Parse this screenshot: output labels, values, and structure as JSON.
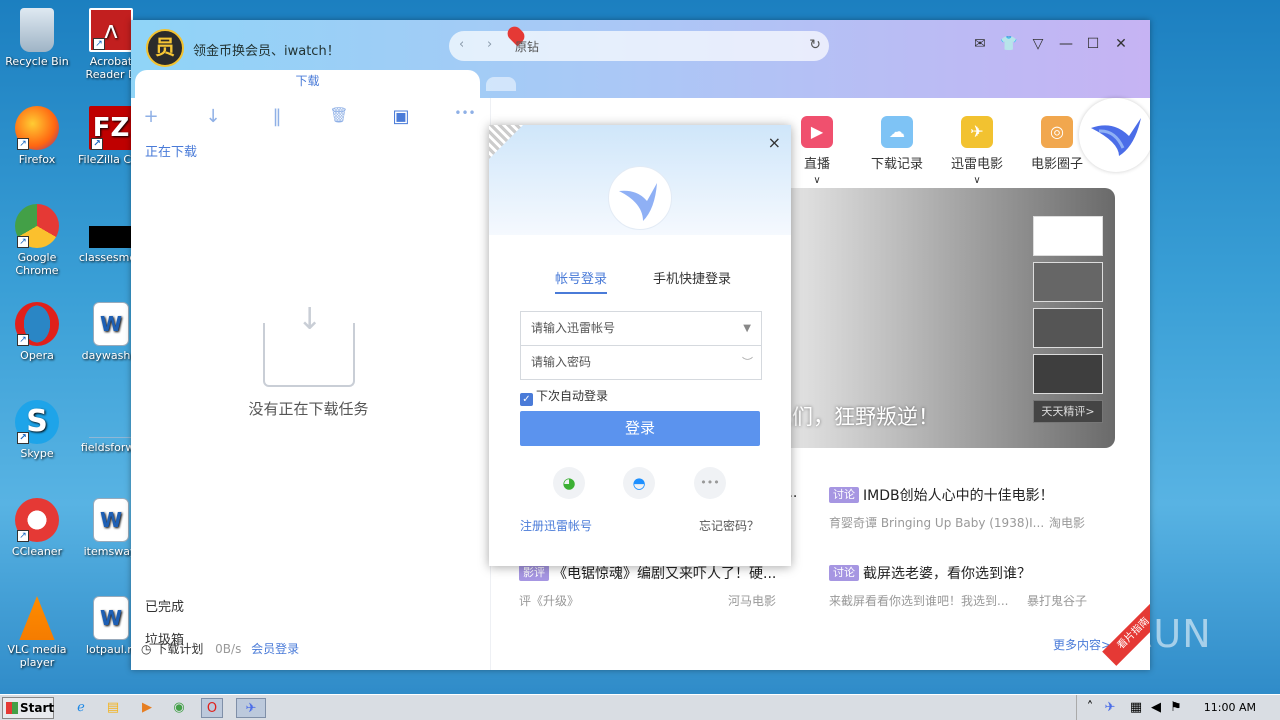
{
  "desktop": {
    "icons": [
      {
        "label": "Recycle Bin"
      },
      {
        "label": "Acrobat Reader D"
      },
      {
        "label": "Firefox"
      },
      {
        "label": "FileZilla Clie"
      },
      {
        "label": "Google Chrome"
      },
      {
        "label": "classesmen"
      },
      {
        "label": "Opera"
      },
      {
        "label": "daywashin"
      },
      {
        "label": "Skype"
      },
      {
        "label": "fieldsforwa"
      },
      {
        "label": "CCleaner"
      },
      {
        "label": "itemsway."
      },
      {
        "label": "VLC media player"
      },
      {
        "label": "lotpaul.rt"
      }
    ]
  },
  "app": {
    "vip_badge": "员",
    "promo_text": "领金币换会员、iwatch！",
    "search": {
      "value": "原钻"
    },
    "download_tab": "下载",
    "toolbar": {
      "add": "+",
      "download": "↓",
      "pause": "‖",
      "delete": "🗑",
      "more": "•••"
    },
    "sub_tab": "正在下载",
    "empty_text": "没有正在下载任务",
    "side": {
      "completed": "已完成",
      "trash": "垃圾箱"
    },
    "status": {
      "plan": "下载计划",
      "speed": "0B/s",
      "login": "会员登录"
    },
    "categories": [
      {
        "label": "直播",
        "color": "#f0506e"
      },
      {
        "label": "下载记录",
        "color": "#7ec3f5"
      },
      {
        "label": "迅雷电影",
        "color": "#f2c230"
      },
      {
        "label": "电影圈子",
        "color": "#f1a74e"
      }
    ],
    "banner": {
      "text": "人们，狂野叛逆！",
      "thumb_label": "天天精评>"
    },
    "news": [
      {
        "tag": "讨论",
        "title": "IMDB创始人心中的十佳电影！",
        "meta_left": "育婴奇谭 Bringing Up Baby (1938)I...",
        "meta_right": "淘电影"
      },
      {
        "tag": "影评",
        "title": "《电锯惊魂》编剧又来吓人了！硬...",
        "meta_left": "评《升级》",
        "meta_right": "河马电影"
      },
      {
        "tag": "讨论",
        "title": "截屏选老婆，看你选到谁？",
        "meta_left": "来截屏看看你选到谁吧！我选到...",
        "meta_right": "暴打鬼谷子"
      }
    ],
    "news_partial": "...",
    "more_link": "更多内容>",
    "corner_ribbon": "看片指南"
  },
  "login_dialog": {
    "close": "×",
    "tab_account": "帐号登录",
    "tab_phone": "手机快捷登录",
    "account_placeholder": "请输入迅雷帐号",
    "password_placeholder": "请输入密码",
    "auto_login": "下次自动登录",
    "login_button": "登录",
    "register": "注册迅雷帐号",
    "forgot": "忘记密码？"
  },
  "taskbar": {
    "start": "Start",
    "time": "11:00 AM"
  },
  "watermark": "ANY.RUN",
  "colors": {
    "accent": "#4a7bd8",
    "login_button": "#5b93ee",
    "tag": "#a696e2"
  }
}
